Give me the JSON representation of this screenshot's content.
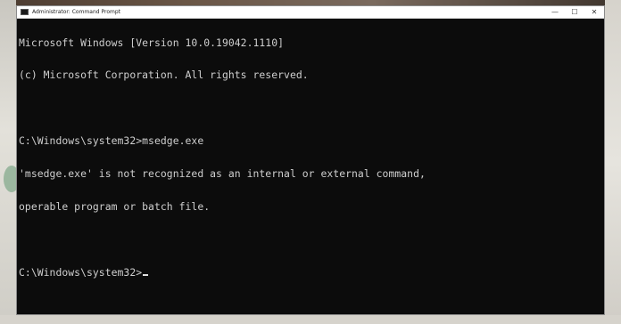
{
  "window": {
    "title": "Administrator: Command Prompt",
    "buttons": {
      "minimize": "—",
      "maximize": "☐",
      "close": "✕"
    }
  },
  "console": {
    "lines": [
      "Microsoft Windows [Version 10.0.19042.1110]",
      "(c) Microsoft Corporation. All rights reserved.",
      "",
      "C:\\Windows\\system32>msedge.exe",
      "'msedge.exe' is not recognized as an internal or external command,",
      "operable program or batch file.",
      "",
      "C:\\Windows\\system32>"
    ]
  },
  "colors": {
    "console_bg": "#0c0c0c",
    "console_text": "#cfcfcf",
    "titlebar_bg": "#ffffff"
  }
}
